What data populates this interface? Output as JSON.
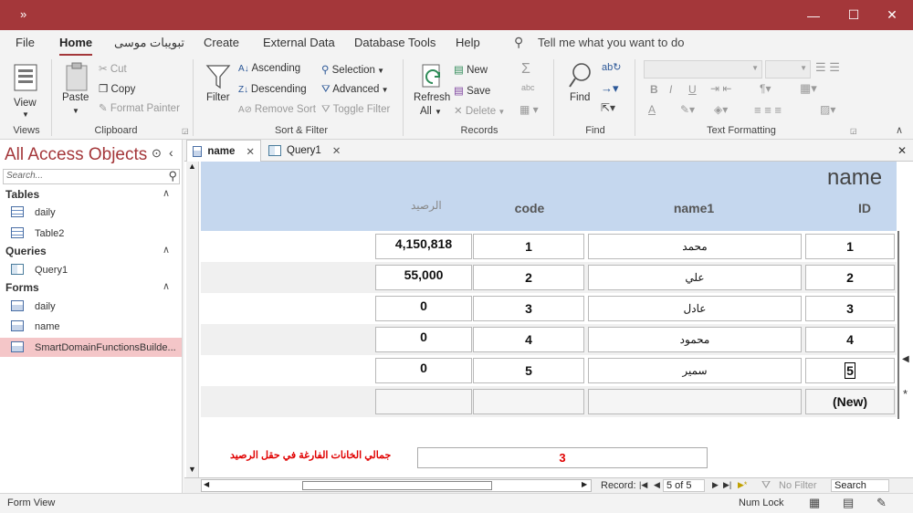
{
  "window": {
    "overflow_glyph": "»",
    "min_glyph": "—",
    "max_glyph": "☐",
    "close_glyph": "✕",
    "accent": "#a4373a"
  },
  "menu": {
    "file": "File",
    "home": "Home",
    "custom": "تبويبات موسى",
    "create": "Create",
    "external": "External Data",
    "dbtools": "Database Tools",
    "help": "Help",
    "tellme": "Tell me what you want to do"
  },
  "ribbon": {
    "views": {
      "view": "View",
      "group": "Views"
    },
    "clipboard": {
      "paste": "Paste",
      "cut": "Cut",
      "copy": "Copy",
      "format_painter": "Format Painter",
      "group": "Clipboard"
    },
    "sortfilter": {
      "filter": "Filter",
      "ascending": "Ascending",
      "descending": "Descending",
      "remove_sort": "Remove Sort",
      "selection": "Selection",
      "advanced": "Advanced",
      "toggle_filter": "Toggle Filter",
      "group": "Sort & Filter"
    },
    "records": {
      "refresh": "Refresh",
      "refresh_all": "All",
      "new": "New",
      "save": "Save",
      "delete": "Delete",
      "group": "Records"
    },
    "find": {
      "find": "Find",
      "group": "Find"
    },
    "textformat": {
      "bold": "B",
      "italic": "I",
      "underline": "U",
      "font_color": "A",
      "group": "Text Formatting"
    }
  },
  "nav": {
    "title": "All Access Objects",
    "search_placeholder": "Search...",
    "tables_header": "Tables",
    "tables": [
      "daily",
      "Table2"
    ],
    "queries_header": "Queries",
    "queries": [
      "Query1"
    ],
    "forms_header": "Forms",
    "forms": [
      "daily",
      "name",
      "SmartDomainFunctionsBuilde..."
    ]
  },
  "tabs": [
    {
      "label": "name",
      "active": true
    },
    {
      "label": "Query1",
      "active": false
    }
  ],
  "form": {
    "title": "name",
    "headers": {
      "balance": "الرصيد",
      "code": "code",
      "name1": "name1",
      "id": "ID"
    },
    "rows": [
      {
        "balance": "4,150,818",
        "code": "1",
        "name1": "محمد",
        "id": "1"
      },
      {
        "balance": "55,000",
        "code": "2",
        "name1": "علي",
        "id": "2"
      },
      {
        "balance": "0",
        "code": "3",
        "name1": "عادل",
        "id": "3"
      },
      {
        "balance": "0",
        "code": "4",
        "name1": "محمود",
        "id": "4"
      },
      {
        "balance": "0",
        "code": "5",
        "name1": "سمير",
        "id": "5"
      }
    ],
    "new_row_label": "(New)",
    "summary_label": "جمالي الخانات الفارغة في حقل الرصيد",
    "summary_value": "3",
    "summary_color": "#e00000",
    "new_record_marker": "*",
    "current_marker": "◀"
  },
  "record_nav": {
    "label": "Record:",
    "position": "5 of 5",
    "no_filter": "No Filter",
    "search": "Search"
  },
  "status": {
    "view": "Form View",
    "numlock": "Num Lock"
  }
}
